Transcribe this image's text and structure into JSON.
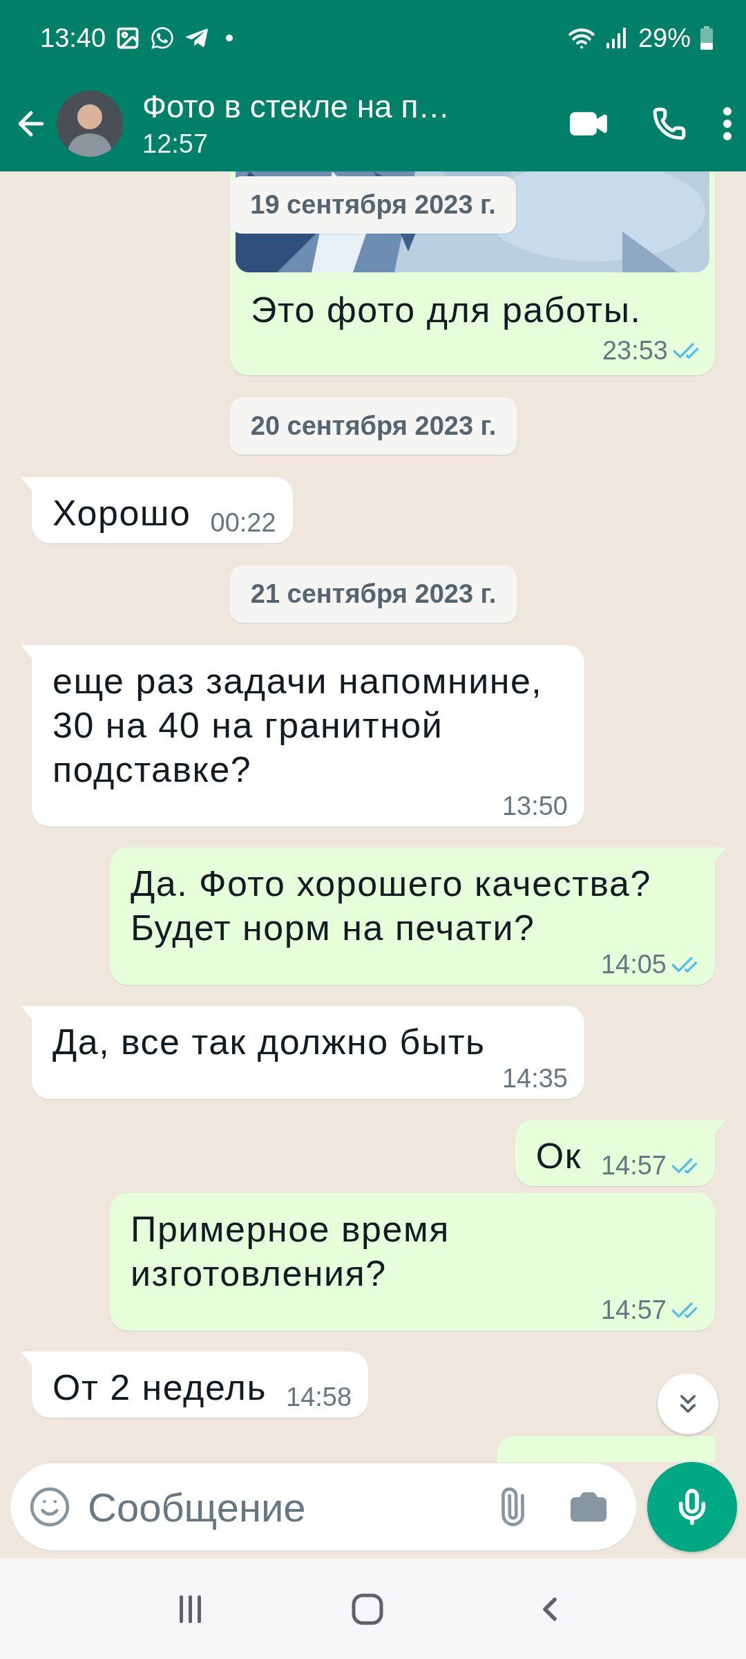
{
  "status_bar": {
    "time": "13:40",
    "battery": "29%"
  },
  "header": {
    "title": "Фото в стекле на п…",
    "subtitle": "12:57"
  },
  "sticky_date": {
    "text": "19 сентября 2023 г."
  },
  "messages": [
    {
      "outgoing": true,
      "tail": false,
      "text": "Это фото для работы.",
      "time": "23:53",
      "read": true
    },
    {
      "kind": "date",
      "text": "20 сентября 2023 г."
    },
    {
      "kind": "text",
      "outgoing": false,
      "tail": true,
      "text": "Хорошо",
      "time": "00:22"
    },
    {
      "kind": "date",
      "text": "21 сентября 2023 г."
    },
    {
      "kind": "text",
      "outgoing": false,
      "tail": true,
      "text": "еще раз задачи напомнине, 30 на 40 на гранитной подставке?",
      "time": "13:50"
    },
    {
      "kind": "text",
      "outgoing": true,
      "tail": true,
      "text": "Да. Фото хорошего качества? Будет норм на печати?",
      "time": "14:05",
      "read": true
    },
    {
      "kind": "text",
      "outgoing": false,
      "tail": true,
      "text": "Да, все так должно быть",
      "time": "14:35"
    },
    {
      "kind": "text",
      "outgoing": true,
      "tail": true,
      "text": "Ок",
      "time": "14:57",
      "read": true
    },
    {
      "kind": "text",
      "outgoing": true,
      "tail": false,
      "text": "Примерное время изготовления?",
      "time": "14:57",
      "read": true
    },
    {
      "kind": "text",
      "outgoing": false,
      "tail": true,
      "text": "От 2 недель",
      "time": "14:58"
    },
    {
      "kind": "cut",
      "outgoing": true,
      "tail": true
    }
  ],
  "composer": {
    "placeholder": "Сообщение"
  }
}
